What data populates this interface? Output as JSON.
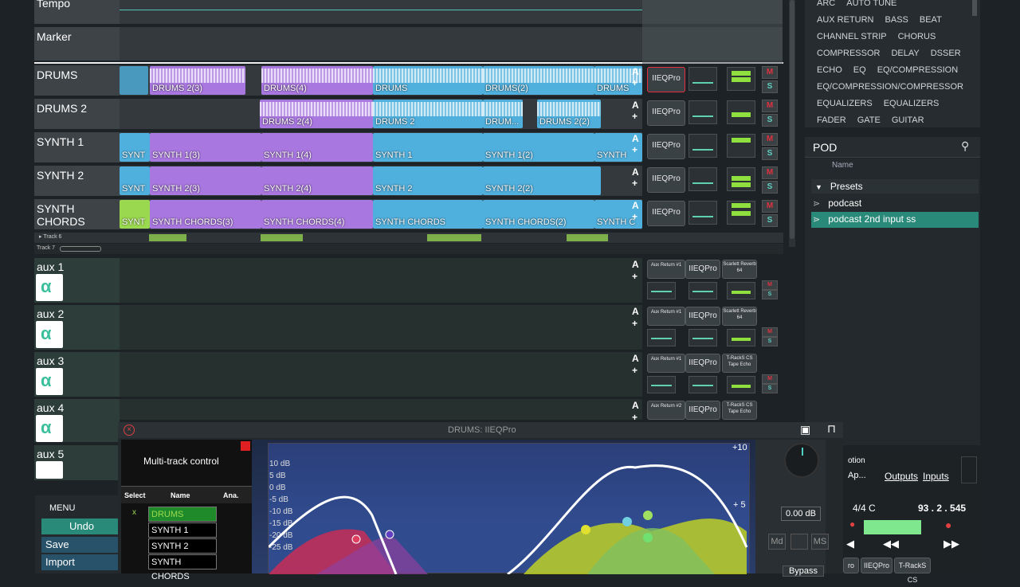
{
  "tracks": {
    "tempo": "Tempo",
    "marker": "Marker",
    "drums": "DRUMS",
    "drums2": "DRUMS 2",
    "synth1": "SYNTH 1",
    "synth2": "SYNTH 2",
    "synth_chords": "SYNTH CHORDS",
    "track6": "Track 6",
    "track7": "Track 7",
    "aux1": "aux 1",
    "aux2": "aux 2",
    "aux3": "aux 3",
    "aux4": "aux 4",
    "aux5": "aux 5"
  },
  "clips": {
    "drums": [
      "DRUMS 2(3)",
      "DRUMS(4)",
      "DRUMS",
      "DRUMS(2)",
      "DRUMS"
    ],
    "drums2": [
      "DRUMS 2(4)",
      "DRUMS 2",
      "DRUM...",
      "DRUMS 2(2)"
    ],
    "synth1": [
      "SYNT",
      "SYNTH 1(3)",
      "SYNTH 1(4)",
      "SYNTH 1",
      "SYNTH 1(2)",
      "SYNTH"
    ],
    "synth2": [
      "SYNT",
      "SYNTH 2(3)",
      "SYNTH 2(4)",
      "SYNTH 2",
      "SYNTH 2(2)"
    ],
    "synth_chords": [
      "SYNT",
      "SYNTH CHORDS(3)",
      "SYNTH CHORDS(4)",
      "SYNTH CHORDS",
      "SYNTH CHORDS(2)",
      "SYNTH C"
    ]
  },
  "strip": {
    "a": "A",
    "plus": "+",
    "m": "M",
    "s": "S",
    "eq": "IIEQPro",
    "aux_return1": "Aux Return #1",
    "aux_return2": "Aux Return #2",
    "scarlett": "Scarlett Reverb 64",
    "trackscs": "T-RackS CS Tape Echo"
  },
  "browser": {
    "tags_row0": [
      "ARC",
      "AUTO TUNE"
    ],
    "tags_row1": [
      "AUX RETURN",
      "BASS",
      "BEAT"
    ],
    "tags_row2": [
      "CHANNEL STRIP",
      "CHORUS"
    ],
    "tags_row3": [
      "COMPRESSOR",
      "DELAY",
      "DSSER"
    ],
    "tags_row4": [
      "ECHO",
      "EQ",
      "EQ/COMPRESSION"
    ],
    "tags_row5": [
      "EQ/COMPRESSION/COMPRESSOR"
    ],
    "tags_row6": [
      "EQUALIZERS",
      "EQUALIZERS"
    ],
    "tags_row7": [
      "FADER",
      "GATE",
      "GUITAR"
    ],
    "search_value": "POD",
    "col_name": "Name",
    "presets_label": "Presets",
    "preset1": "podcast",
    "preset2": "podcast 2nd input ss"
  },
  "plugin": {
    "title": "DRUMS: IIEQPro",
    "mt_title": "Multi-track control",
    "col_select": "Select",
    "col_name": "Name",
    "col_ana": "Ana.",
    "rows": [
      "DRUMS",
      "SYNTH 1",
      "SYNTH 2",
      "SYNTH CHORDS"
    ],
    "row_mark": "x",
    "db_labels": [
      "10 dB",
      "5 dB",
      "0 dB",
      "-5 dB",
      "-10 dB",
      "-15 dB",
      "-20 dB",
      "-25 dB"
    ],
    "plus10": "+10",
    "plus5": "+ 5",
    "gain": "0.00 dB",
    "md": "Md",
    "ms": "MS",
    "bypass": "Bypass"
  },
  "menu": {
    "title": "MENU",
    "undo": "Undo",
    "save": "Save",
    "import": "Import"
  },
  "transport": {
    "option": "otion",
    "ap": "Ap...",
    "outputs": "Outputs",
    "inputs": "Inputs",
    "sig": "4/4 C",
    "pos": "93 . 2 . 545",
    "plugs": [
      "ro",
      "IIEQPro",
      "T-RackS CS"
    ]
  },
  "colors": {
    "purple": "#a977e0",
    "blue": "#4fb0de",
    "green": "#9ad84f",
    "selected": "#2a8a7a"
  }
}
